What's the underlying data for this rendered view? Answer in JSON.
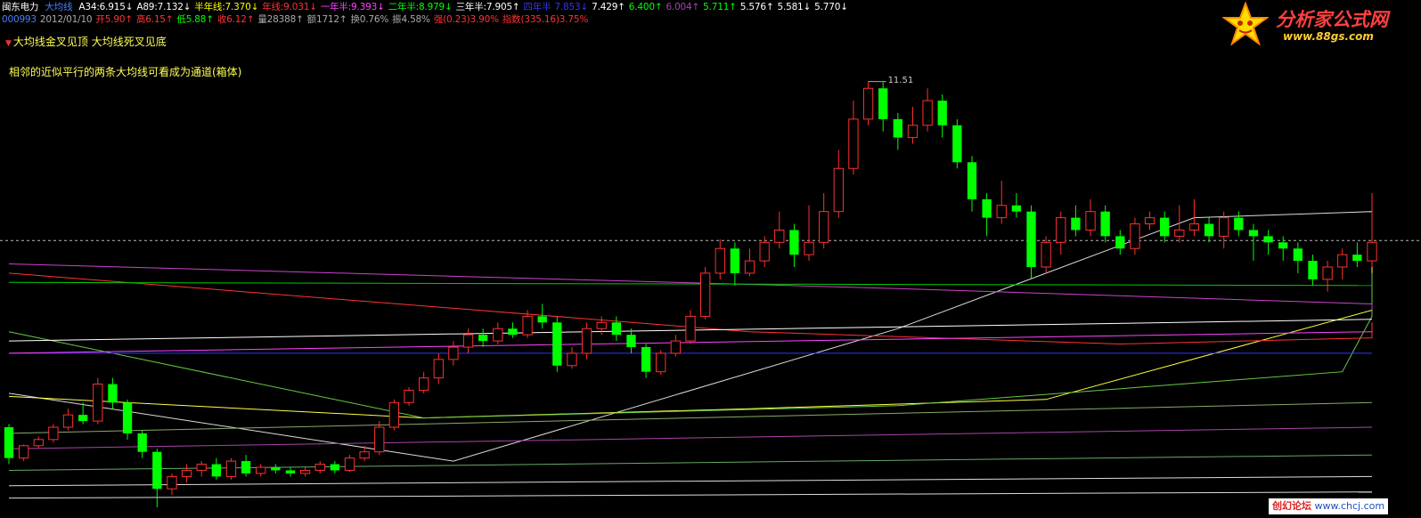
{
  "header": {
    "stock_name": "闽东电力",
    "indicator_name": "大均线",
    "indicator_values": [
      {
        "label": "A34:6.915↓",
        "color": "#ffffff"
      },
      {
        "label": "A89:7.132↓",
        "color": "#ffffff"
      },
      {
        "label": "半年线:7.370↓",
        "color": "#ffff00"
      },
      {
        "label": "年线:9.031↓",
        "color": "#ff3333"
      },
      {
        "label": "一年半:9.393↓",
        "color": "#ff44ff"
      },
      {
        "label": "二年半:8.979↓",
        "color": "#00ff00"
      },
      {
        "label": "三年半:7.905↑",
        "color": "#ffffff"
      },
      {
        "label": "四年半",
        "color": "#3333ff"
      },
      {
        "label": "7.853↓",
        "color": "#3333ff"
      },
      {
        "label": "7.429↑",
        "color": "#ffffff"
      },
      {
        "label": "6.400↑",
        "color": "#00ff00"
      },
      {
        "label": "6.004↑",
        "color": "#aa44aa"
      },
      {
        "label": "5.711↑",
        "color": "#00ff00"
      },
      {
        "label": "5.576↑",
        "color": "#ffffff"
      },
      {
        "label": "5.581↓",
        "color": "#ffffff"
      },
      {
        "label": "5.770↓",
        "color": "#ffffff"
      }
    ],
    "quote_fields": [
      {
        "label": "000993",
        "color": "#4a7fff"
      },
      {
        "label": "2012/01/10",
        "color": "#aaaaaa"
      },
      {
        "label": "开5.90↑",
        "color": "#ff3333"
      },
      {
        "label": "高6.15↑",
        "color": "#ff3333"
      },
      {
        "label": "低5.88↑",
        "color": "#00ff00"
      },
      {
        "label": "收6.12↑",
        "color": "#ff3333"
      },
      {
        "label": "量28388↑",
        "color": "#aaaaaa"
      },
      {
        "label": "额1712↑",
        "color": "#aaaaaa"
      },
      {
        "label": "换0.76%",
        "color": "#aaaaaa"
      },
      {
        "label": "振4.58%",
        "color": "#aaaaaa"
      },
      {
        "label": "强(0.23)3.90%",
        "color": "#ff3333"
      },
      {
        "label": "指数(335.16)3.75%",
        "color": "#ff3333"
      }
    ]
  },
  "signal_legend": "大均线金叉见顶   大均线死叉见底",
  "annotation": "相邻的近似平行的两条大均线可看成为通道(箱体)",
  "peak_label": "11.51",
  "logo": {
    "title": "分析家公式网",
    "url": "www.88gs.com"
  },
  "watermark": {
    "part1": "创幻论坛",
    "part2": "www.chcj.com"
  },
  "colors": {
    "up": "#ff3030",
    "down": "#00ff00",
    "background": "#000000"
  },
  "chart_data": {
    "type": "candlestick",
    "ylim": [
      4.6,
      12.4
    ],
    "reference_price": 8.93,
    "peak_value": 11.51,
    "candles": [
      [
        5.9,
        5.4,
        5.95,
        5.3
      ],
      [
        5.4,
        5.6,
        5.62,
        5.35
      ],
      [
        5.6,
        5.7,
        5.75,
        5.55
      ],
      [
        5.7,
        5.9,
        5.95,
        5.65
      ],
      [
        5.9,
        6.1,
        6.2,
        5.85
      ],
      [
        6.1,
        6.0,
        6.3,
        5.95
      ],
      [
        6.0,
        6.6,
        6.7,
        5.95
      ],
      [
        6.6,
        6.3,
        6.7,
        6.2
      ],
      [
        6.3,
        5.8,
        6.35,
        5.7
      ],
      [
        5.8,
        5.5,
        5.85,
        5.4
      ],
      [
        5.5,
        4.9,
        5.55,
        4.6
      ],
      [
        4.9,
        5.1,
        5.15,
        4.8
      ],
      [
        5.1,
        5.2,
        5.3,
        5.0
      ],
      [
        5.2,
        5.3,
        5.35,
        5.1
      ],
      [
        5.3,
        5.1,
        5.4,
        5.05
      ],
      [
        5.1,
        5.35,
        5.4,
        5.05
      ],
      [
        5.35,
        5.15,
        5.45,
        5.1
      ],
      [
        5.15,
        5.25,
        5.3,
        5.1
      ],
      [
        5.25,
        5.2,
        5.3,
        5.15
      ],
      [
        5.2,
        5.15,
        5.25,
        5.1
      ],
      [
        5.15,
        5.2,
        5.25,
        5.1
      ],
      [
        5.2,
        5.3,
        5.35,
        5.15
      ],
      [
        5.3,
        5.2,
        5.35,
        5.15
      ],
      [
        5.2,
        5.4,
        5.45,
        5.18
      ],
      [
        5.4,
        5.5,
        5.6,
        5.35
      ],
      [
        5.5,
        5.9,
        6.0,
        5.45
      ],
      [
        5.9,
        6.3,
        6.35,
        5.85
      ],
      [
        6.3,
        6.5,
        6.55,
        6.25
      ],
      [
        6.5,
        6.7,
        6.8,
        6.45
      ],
      [
        6.7,
        7.0,
        7.1,
        6.6
      ],
      [
        7.0,
        7.2,
        7.3,
        6.9
      ],
      [
        7.2,
        7.4,
        7.5,
        7.1
      ],
      [
        7.4,
        7.3,
        7.5,
        7.2
      ],
      [
        7.3,
        7.5,
        7.6,
        7.25
      ],
      [
        7.5,
        7.4,
        7.6,
        7.35
      ],
      [
        7.4,
        7.7,
        7.8,
        7.35
      ],
      [
        7.7,
        7.6,
        7.9,
        7.5
      ],
      [
        7.6,
        6.9,
        7.7,
        6.8
      ],
      [
        6.9,
        7.1,
        7.2,
        6.85
      ],
      [
        7.1,
        7.5,
        7.6,
        7.0
      ],
      [
        7.5,
        7.6,
        7.7,
        7.4
      ],
      [
        7.6,
        7.4,
        7.7,
        7.3
      ],
      [
        7.4,
        7.2,
        7.5,
        7.1
      ],
      [
        7.2,
        6.8,
        7.25,
        6.7
      ],
      [
        6.8,
        7.1,
        7.15,
        6.75
      ],
      [
        7.1,
        7.3,
        7.4,
        7.05
      ],
      [
        7.3,
        7.7,
        7.8,
        7.25
      ],
      [
        7.7,
        8.4,
        8.5,
        7.65
      ],
      [
        8.4,
        8.8,
        8.95,
        8.3
      ],
      [
        8.8,
        8.4,
        8.9,
        8.2
      ],
      [
        8.4,
        8.6,
        8.8,
        8.35
      ],
      [
        8.6,
        8.9,
        9.0,
        8.5
      ],
      [
        8.9,
        9.1,
        9.4,
        8.8
      ],
      [
        9.1,
        8.7,
        9.2,
        8.5
      ],
      [
        8.7,
        8.9,
        9.5,
        8.6
      ],
      [
        8.9,
        9.4,
        9.7,
        8.8
      ],
      [
        9.4,
        10.1,
        10.4,
        9.3
      ],
      [
        10.1,
        10.9,
        11.2,
        10.0
      ],
      [
        10.9,
        11.4,
        11.51,
        10.8
      ],
      [
        11.4,
        10.9,
        11.5,
        10.7
      ],
      [
        10.9,
        10.6,
        11.0,
        10.4
      ],
      [
        10.6,
        10.8,
        11.1,
        10.5
      ],
      [
        10.8,
        11.2,
        11.4,
        10.7
      ],
      [
        11.2,
        10.8,
        11.3,
        10.6
      ],
      [
        10.8,
        10.2,
        10.9,
        10.1
      ],
      [
        10.2,
        9.6,
        10.3,
        9.4
      ],
      [
        9.6,
        9.3,
        9.7,
        9.0
      ],
      [
        9.3,
        9.5,
        9.9,
        9.2
      ],
      [
        9.5,
        9.4,
        9.7,
        9.3
      ],
      [
        9.4,
        8.5,
        9.5,
        8.3
      ],
      [
        8.5,
        8.9,
        9.0,
        8.4
      ],
      [
        8.9,
        9.3,
        9.4,
        8.7
      ],
      [
        9.3,
        9.1,
        9.5,
        9.0
      ],
      [
        9.1,
        9.4,
        9.6,
        9.0
      ],
      [
        9.4,
        9.0,
        9.5,
        8.9
      ],
      [
        9.0,
        8.8,
        9.1,
        8.7
      ],
      [
        8.8,
        9.2,
        9.3,
        8.7
      ],
      [
        9.2,
        9.3,
        9.4,
        9.1
      ],
      [
        9.3,
        9.0,
        9.4,
        8.9
      ],
      [
        9.0,
        9.1,
        9.5,
        8.9
      ],
      [
        9.1,
        9.2,
        9.6,
        9.0
      ],
      [
        9.2,
        9.0,
        9.3,
        8.9
      ],
      [
        9.0,
        9.3,
        9.4,
        8.8
      ],
      [
        9.3,
        9.1,
        9.4,
        9.0
      ],
      [
        9.1,
        9.0,
        9.2,
        8.6
      ],
      [
        9.0,
        8.9,
        9.1,
        8.7
      ],
      [
        8.9,
        8.8,
        9.0,
        8.6
      ],
      [
        8.8,
        8.6,
        8.9,
        8.4
      ],
      [
        8.6,
        8.3,
        8.7,
        8.2
      ],
      [
        8.3,
        8.5,
        8.6,
        8.1
      ],
      [
        8.5,
        8.7,
        8.8,
        8.3
      ],
      [
        8.7,
        8.6,
        8.9,
        8.5
      ],
      [
        8.6,
        8.9,
        9.7,
        8.5
      ]
    ],
    "moving_averages": [
      {
        "name": "A34",
        "color": "#dddddd",
        "points": [
          [
            0,
            6.45
          ],
          [
            30,
            5.35
          ],
          [
            60,
            7.5
          ],
          [
            80,
            9.3
          ],
          [
            100,
            9.4
          ],
          [
            118,
            9.3
          ],
          [
            127,
            9.05
          ]
        ]
      },
      {
        "name": "A89",
        "color": "#ffff44",
        "points": [
          [
            0,
            6.4
          ],
          [
            28,
            6.05
          ],
          [
            50,
            6.2
          ],
          [
            70,
            6.35
          ],
          [
            95,
            7.8
          ],
          [
            115,
            8.55
          ],
          [
            127,
            8.9
          ]
        ]
      },
      {
        "name": "半年线",
        "color": "#66cc44",
        "points": [
          [
            0,
            7.45
          ],
          [
            28,
            6.05
          ],
          [
            60,
            6.25
          ],
          [
            90,
            6.8
          ],
          [
            110,
            7.7
          ],
          [
            127,
            8.4
          ]
        ]
      },
      {
        "name": "年线",
        "color": "#ff3333",
        "points": [
          [
            0,
            8.4
          ],
          [
            50,
            7.45
          ],
          [
            75,
            7.25
          ],
          [
            100,
            7.35
          ],
          [
            127,
            7.6
          ]
        ]
      },
      {
        "name": "一年半",
        "color": "#cc44cc",
        "points": [
          [
            0,
            8.55
          ],
          [
            60,
            8.15
          ],
          [
            100,
            7.9
          ],
          [
            127,
            7.8
          ]
        ]
      },
      {
        "name": "二年半",
        "color": "#00cc00",
        "points": [
          [
            0,
            8.25
          ],
          [
            127,
            8.2
          ]
        ]
      },
      {
        "name": "三年半",
        "color": "#ffffff",
        "points": [
          [
            0,
            7.3
          ],
          [
            127,
            7.65
          ]
        ]
      },
      {
        "name": "四年半",
        "color": "#3333ff",
        "points": [
          [
            0,
            7.1
          ],
          [
            127,
            7.1
          ]
        ]
      },
      {
        "name": "5.7",
        "color": "#ff44ff",
        "points": [
          [
            0,
            7.1
          ],
          [
            127,
            7.45
          ]
        ]
      },
      {
        "name": "6.4",
        "color": "#88aa66",
        "points": [
          [
            0,
            5.8
          ],
          [
            127,
            6.3
          ]
        ]
      },
      {
        "name": "6.0",
        "color": "#aa44aa",
        "points": [
          [
            0,
            5.55
          ],
          [
            127,
            5.9
          ]
        ]
      },
      {
        "name": "5.71",
        "color": "#66aa66",
        "points": [
          [
            0,
            5.2
          ],
          [
            127,
            5.45
          ]
        ]
      },
      {
        "name": "5.58",
        "color": "#dddddd",
        "points": [
          [
            0,
            4.95
          ],
          [
            127,
            5.1
          ]
        ]
      },
      {
        "name": "5.77",
        "color": "#dddddd",
        "points": [
          [
            0,
            4.75
          ],
          [
            127,
            4.85
          ]
        ]
      }
    ]
  }
}
